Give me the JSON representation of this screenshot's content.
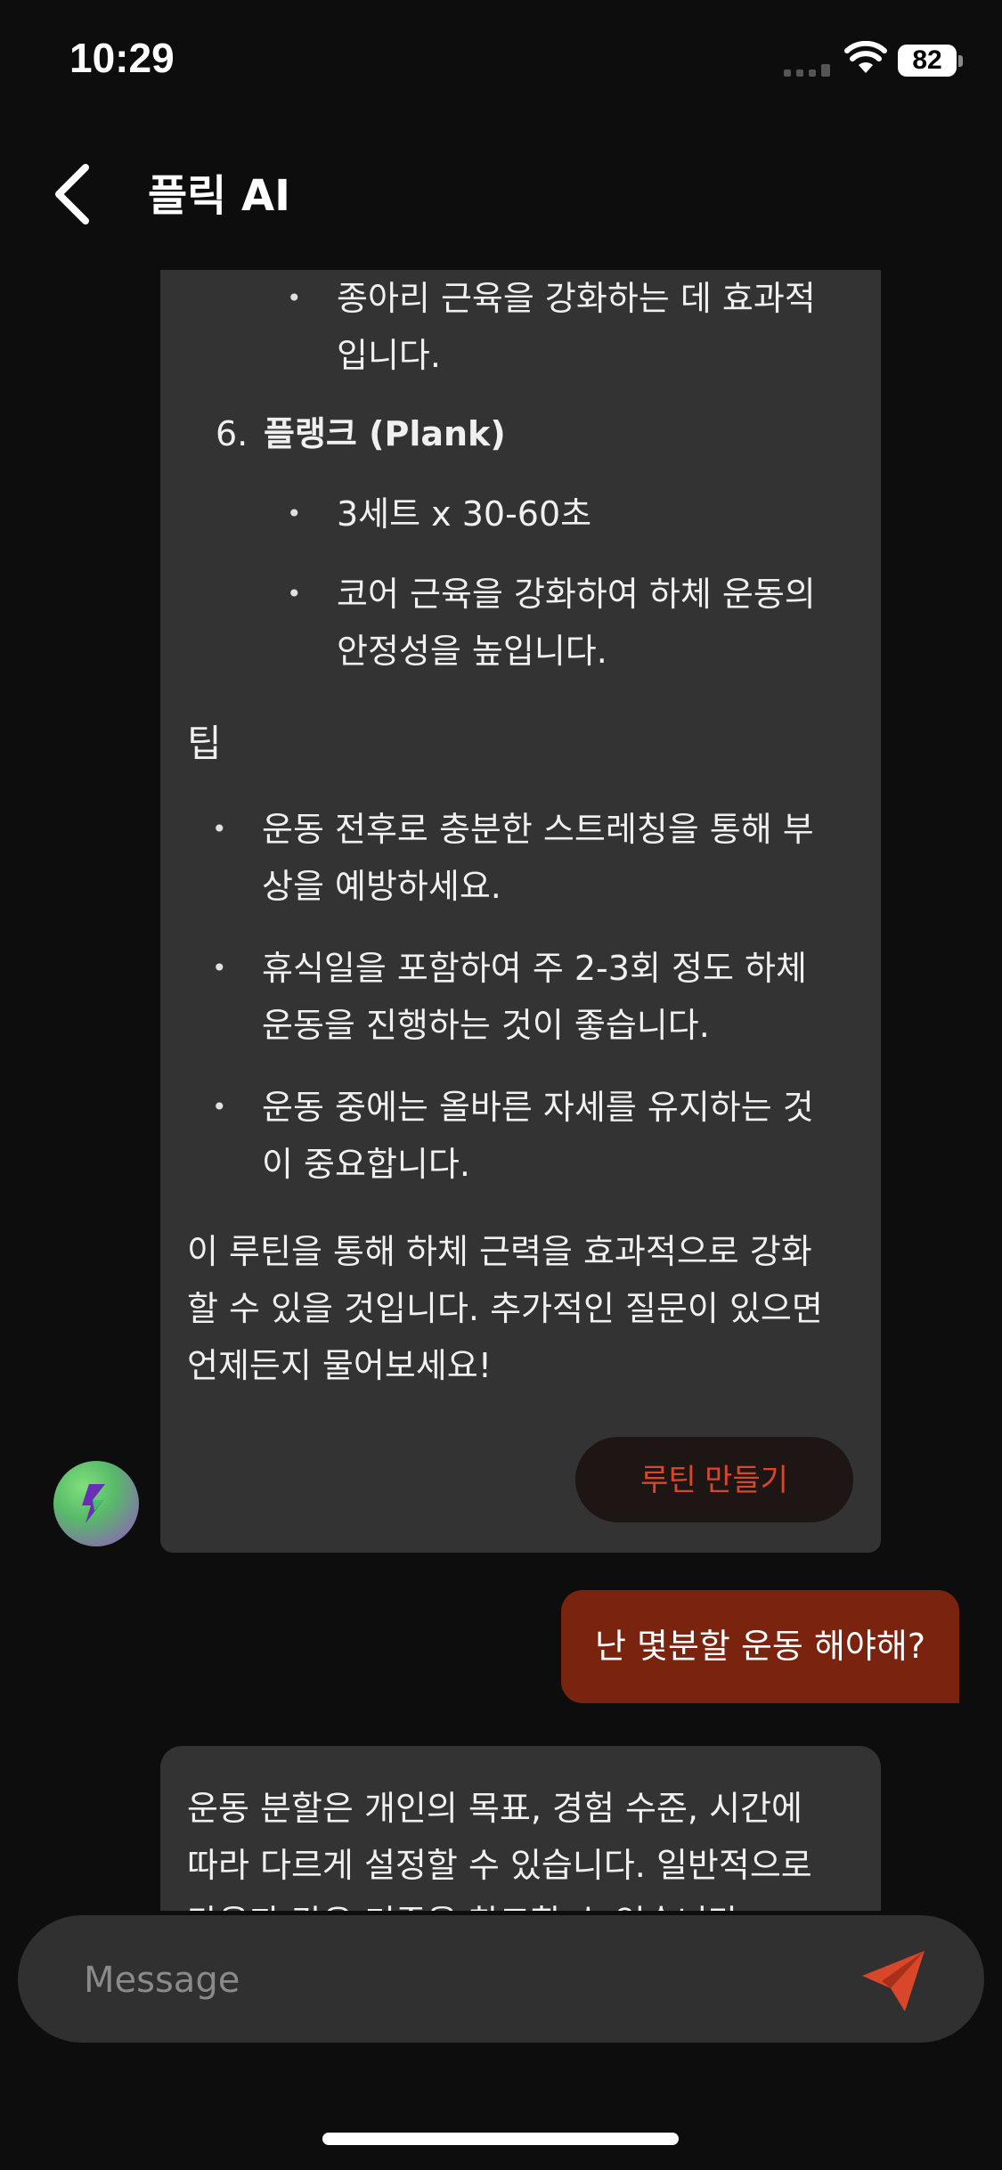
{
  "status_bar": {
    "time": "10:29",
    "battery": "82"
  },
  "nav": {
    "title": "플릭 AI"
  },
  "bot_message_1": {
    "lines": [
      "종아리 근육을 강화하는 데 효과적",
      "입니다.",
      "6.",
      "플랭크 (Plank)",
      "3세트 x 30-60초",
      "코어 근육을 강화하여 하체 운동의",
      "안정성을 높입니다.",
      "팁",
      "운동 전후로 충분한 스트레칭을 통해 부",
      "상을 예방하세요.",
      "휴식일을 포함하여 주 2-3회 정도 하체",
      "운동을 진행하는 것이 좋습니다.",
      "운동 중에는 올바른 자세를 유지하는 것",
      "이 중요합니다.",
      "이 루틴을 통해 하체 근력을 효과적으로 강화",
      "할 수 있을 것입니다. 추가적인 질문이 있으면",
      "언제든지 물어보세요!"
    ],
    "bullet": "•",
    "routine_button": "루틴 만들기"
  },
  "user_message": {
    "text": "난 몇분할 운동 해야해?"
  },
  "bot_message_2": {
    "lines": [
      "운동 분할은 개인의 목표, 경험 수준, 시간에",
      "따라 다르게 설정할 수 있습니다. 일반적으로",
      "다음과 같은 기준을 참고할 수 있습니다:"
    ]
  },
  "composer": {
    "placeholder": "Message"
  },
  "colors": {
    "accent": "#d9472b",
    "user_bubble": "#7a2410",
    "bot_bubble": "#333333",
    "background": "#0d0d0d"
  },
  "icons": {
    "back": "chevron-left-icon",
    "send": "send-icon",
    "wifi": "wifi-icon",
    "signal": "signal-icon",
    "avatar": "flick-logo-icon"
  }
}
